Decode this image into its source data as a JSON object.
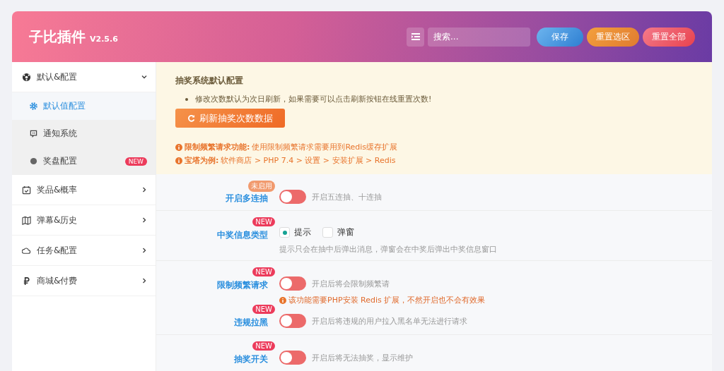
{
  "header": {
    "title": "子比插件",
    "version": "V2.5.6",
    "search": {
      "placeholder": "搜索..."
    },
    "buttons": [
      {
        "label": "保存",
        "kind": "save"
      },
      {
        "label": "重置选区",
        "kind": "reset-section"
      },
      {
        "label": "重置全部",
        "kind": "reset-all"
      }
    ]
  },
  "sidebar": {
    "items": [
      {
        "label": "默认&配置",
        "expanded": true,
        "children": [
          {
            "label": "默认值配置",
            "selected": true
          },
          {
            "label": "通知系统",
            "selected": false
          },
          {
            "label": "奖盘配置",
            "selected": false,
            "badge": "NEW"
          }
        ]
      },
      {
        "label": "奖品&概率",
        "expanded": false
      },
      {
        "label": "弹幕&历史",
        "expanded": false
      },
      {
        "label": "任务&配置",
        "expanded": false
      },
      {
        "label": "商城&付费",
        "expanded": false
      }
    ]
  },
  "notice": {
    "title": "抽奖系统默认配置",
    "bullets": [
      "修改次数默认为次日刷新，如果需要可以点击刷新按钮在线重置次数!"
    ],
    "button": "刷新抽奖次数数据",
    "notes": [
      {
        "label": "限制频繁请求功能:",
        "text": "使用限制频繁请求需要用到Redis缓存扩展"
      },
      {
        "label": "宝塔为例:",
        "text": "软件商店 > PHP 7.4 > 设置 > 安装扩展 > Redis"
      }
    ]
  },
  "settings": [
    {
      "fields": [
        {
          "label": "开启多连抽",
          "badge": {
            "label": "未启用",
            "kind": "status"
          },
          "kind": "switch",
          "on": false,
          "desc": "开启五连抽、十连抽"
        }
      ]
    },
    {
      "fields": [
        {
          "label": "中奖信息类型",
          "badge": {
            "label": "NEW",
            "kind": "new"
          },
          "kind": "radio",
          "options": [
            {
              "label": "提示",
              "selected": true
            },
            {
              "label": "弹窗",
              "selected": false
            }
          ],
          "help": "提示只会在抽中后弹出消息，弹窗会在中奖后弹出中奖信息窗口"
        }
      ]
    },
    {
      "fields": [
        {
          "label": "限制频繁请求",
          "badge": {
            "label": "NEW",
            "kind": "new"
          },
          "kind": "switch",
          "on": false,
          "desc": "开启后将会限制频繁请",
          "warning": "该功能需要PHP安装 Redis 扩展，不然开启也不会有效果"
        },
        {
          "label": "违规拉黑",
          "badge": {
            "label": "NEW",
            "kind": "new"
          },
          "kind": "switch",
          "on": false,
          "desc": "开启后将违规的用户拉入黑名单无法进行请求"
        }
      ]
    },
    {
      "fields": [
        {
          "label": "抽奖开关",
          "badge": {
            "label": "NEW",
            "kind": "new"
          },
          "kind": "switch",
          "on": false,
          "desc": "开启后将无法抽奖，显示维护"
        }
      ]
    }
  ]
}
